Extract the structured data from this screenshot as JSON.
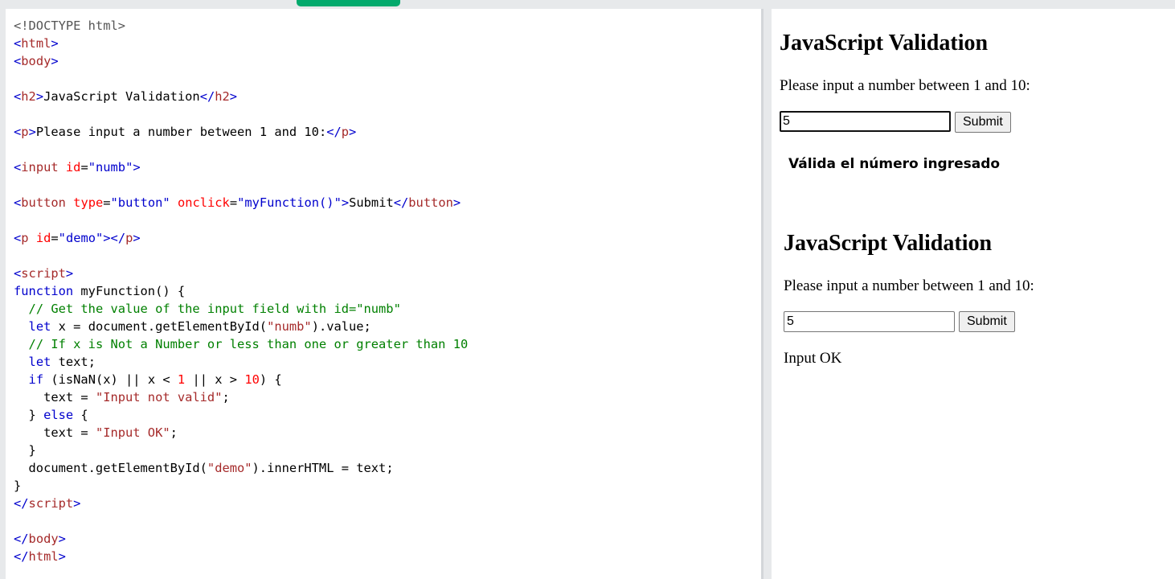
{
  "code": {
    "lines": [
      [
        [
          "dt",
          "<!DOCTYPE html>"
        ]
      ],
      [
        [
          "br",
          "<"
        ],
        [
          "tg",
          "html"
        ],
        [
          "br",
          ">"
        ]
      ],
      [
        [
          "br",
          "<"
        ],
        [
          "tg",
          "body"
        ],
        [
          "br",
          ">"
        ]
      ],
      [],
      [
        [
          "br",
          "<"
        ],
        [
          "tg",
          "h2"
        ],
        [
          "br",
          ">"
        ],
        [
          "pl",
          "JavaScript Validation"
        ],
        [
          "br",
          "</"
        ],
        [
          "tg",
          "h2"
        ],
        [
          "br",
          ">"
        ]
      ],
      [],
      [
        [
          "br",
          "<"
        ],
        [
          "tg",
          "p"
        ],
        [
          "br",
          ">"
        ],
        [
          "pl",
          "Please input a number between 1 and 10:"
        ],
        [
          "br",
          "</"
        ],
        [
          "tg",
          "p"
        ],
        [
          "br",
          ">"
        ]
      ],
      [],
      [
        [
          "br",
          "<"
        ],
        [
          "tg",
          "input"
        ],
        [
          "pl",
          " "
        ],
        [
          "at",
          "id"
        ],
        [
          "pl",
          "="
        ],
        [
          "av",
          "\"numb\""
        ],
        [
          "br",
          ">"
        ]
      ],
      [],
      [
        [
          "br",
          "<"
        ],
        [
          "tg",
          "button"
        ],
        [
          "pl",
          " "
        ],
        [
          "at",
          "type"
        ],
        [
          "pl",
          "="
        ],
        [
          "av",
          "\"button\""
        ],
        [
          "pl",
          " "
        ],
        [
          "at",
          "onclick"
        ],
        [
          "pl",
          "="
        ],
        [
          "av",
          "\"myFunction()\""
        ],
        [
          "br",
          ">"
        ],
        [
          "pl",
          "Submit"
        ],
        [
          "br",
          "</"
        ],
        [
          "tg",
          "button"
        ],
        [
          "br",
          ">"
        ]
      ],
      [],
      [
        [
          "br",
          "<"
        ],
        [
          "tg",
          "p"
        ],
        [
          "pl",
          " "
        ],
        [
          "at",
          "id"
        ],
        [
          "pl",
          "="
        ],
        [
          "av",
          "\"demo\""
        ],
        [
          "br",
          "></"
        ],
        [
          "tg",
          "p"
        ],
        [
          "br",
          ">"
        ]
      ],
      [],
      [
        [
          "br",
          "<"
        ],
        [
          "tg",
          "script"
        ],
        [
          "br",
          ">"
        ]
      ],
      [
        [
          "kw",
          "function"
        ],
        [
          "pl",
          " myFunction() {"
        ]
      ],
      [
        [
          "pl",
          "  "
        ],
        [
          "cm",
          "// Get the value of the input field with id=\"numb\""
        ]
      ],
      [
        [
          "pl",
          "  "
        ],
        [
          "kw",
          "let"
        ],
        [
          "pl",
          " x = document.getElementById("
        ],
        [
          "st",
          "\"numb\""
        ],
        [
          "pl",
          ").value;"
        ]
      ],
      [
        [
          "pl",
          "  "
        ],
        [
          "cm",
          "// If x is Not a Number or less than one or greater than 10"
        ]
      ],
      [
        [
          "pl",
          "  "
        ],
        [
          "kw",
          "let"
        ],
        [
          "pl",
          " text;"
        ]
      ],
      [
        [
          "pl",
          "  "
        ],
        [
          "kw",
          "if"
        ],
        [
          "pl",
          " (isNaN(x) || x < "
        ],
        [
          "nm",
          "1"
        ],
        [
          "pl",
          " || x > "
        ],
        [
          "nm",
          "10"
        ],
        [
          "pl",
          ") {"
        ]
      ],
      [
        [
          "pl",
          "    text = "
        ],
        [
          "st",
          "\"Input not valid\""
        ],
        [
          "pl",
          ";"
        ]
      ],
      [
        [
          "pl",
          "  } "
        ],
        [
          "kw",
          "else"
        ],
        [
          "pl",
          " {"
        ]
      ],
      [
        [
          "pl",
          "    text = "
        ],
        [
          "st",
          "\"Input OK\""
        ],
        [
          "pl",
          ";"
        ]
      ],
      [
        [
          "pl",
          "  }"
        ]
      ],
      [
        [
          "pl",
          "  document.getElementById("
        ],
        [
          "st",
          "\"demo\""
        ],
        [
          "pl",
          ").innerHTML = text;"
        ]
      ],
      [
        [
          "pl",
          "}"
        ]
      ],
      [
        [
          "br",
          "</"
        ],
        [
          "tg",
          "script"
        ],
        [
          "br",
          ">"
        ]
      ],
      [],
      [
        [
          "br",
          "</"
        ],
        [
          "tg",
          "body"
        ],
        [
          "br",
          ">"
        ]
      ],
      [
        [
          "br",
          "</"
        ],
        [
          "tg",
          "html"
        ],
        [
          "br",
          ">"
        ]
      ]
    ]
  },
  "preview": {
    "first": {
      "heading": "JavaScript Validation",
      "prompt": "Please input a number between 1 and 10:",
      "input_value": "5",
      "button_label": "Submit"
    },
    "caption": "Válida el número ingresado",
    "second": {
      "heading": "JavaScript Validation",
      "prompt": "Please input a number between 1 and 10:",
      "input_value": "5",
      "button_label": "Submit",
      "result": "Input OK"
    }
  },
  "colors": {
    "accent_tab": "#04aa6d",
    "tag": "#a52a2a",
    "bracket": "#0000cd",
    "attribute": "#ff0000",
    "comment": "#008000"
  }
}
